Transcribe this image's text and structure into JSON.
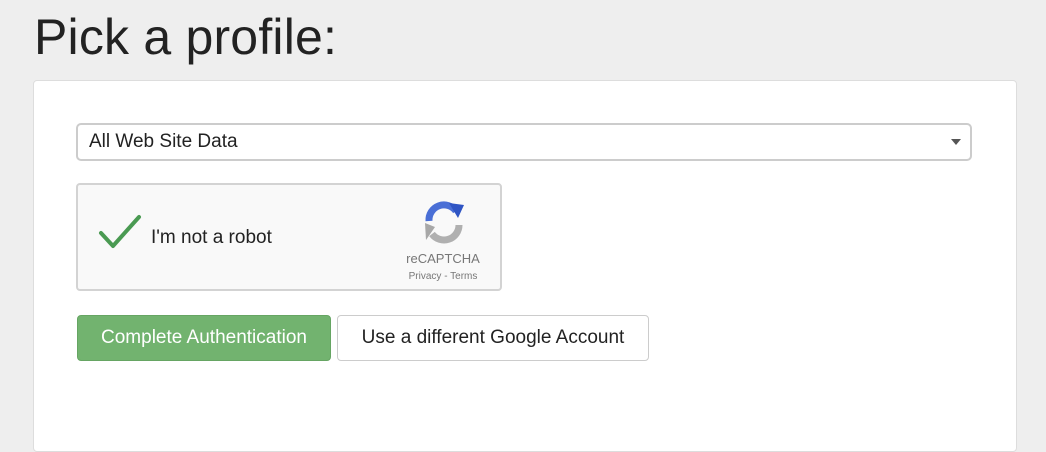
{
  "page": {
    "title": "Pick a profile:"
  },
  "profile_select": {
    "selected": "All Web Site Data"
  },
  "recaptcha": {
    "label": "I'm not a robot",
    "brand": "reCAPTCHA",
    "links": "Privacy - Terms",
    "checked": true,
    "check_color": "#4a9a52"
  },
  "actions": {
    "complete_label": "Complete Authentication",
    "switch_account_label": "Use a different Google Account"
  },
  "colors": {
    "primary_button": "#72b36f",
    "background": "#eeeeee"
  }
}
